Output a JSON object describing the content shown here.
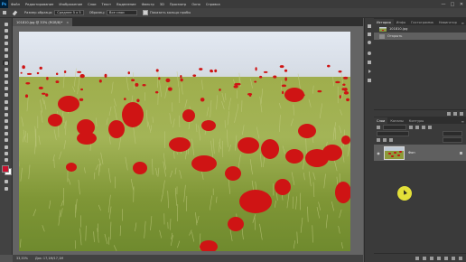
{
  "menubar": {
    "logo": "Ps",
    "items": [
      "Файл",
      "Редактирование",
      "Изображение",
      "Слои",
      "Текст",
      "Выделение",
      "Фильтр",
      "3D",
      "Просмотр",
      "Окно",
      "Справка"
    ],
    "window_controls": [
      "—",
      "□",
      "✕"
    ]
  },
  "options": {
    "size_label": "Размер образца:",
    "size_value": "Среднее 5 x 5",
    "sample_label": "Образец:",
    "sample_value": "Все слои",
    "ring_label": "Показать кольцо пробы"
  },
  "document": {
    "tab_title": "101810.jpg @ 33% (RGB/8)*",
    "close": "×"
  },
  "status": {
    "zoom": "33,33%",
    "doc_info": "Док: 17,1M/17,1M"
  },
  "history_panel": {
    "tabs": [
      "История",
      "Инфо",
      "Гистограмма",
      "Навигатор"
    ],
    "active_tab": "История",
    "menu": "≡",
    "rows": [
      {
        "label": "101810.jpg",
        "selected": false
      },
      {
        "label": "Открыть",
        "selected": true
      }
    ]
  },
  "layers_panel": {
    "tabs": [
      "Слои",
      "Каналы",
      "Контуры"
    ],
    "active_tab": "Слои",
    "menu": "≡",
    "layer": {
      "name": "Фон",
      "visible": true,
      "locked": true
    }
  },
  "colors": {
    "foreground": "#c8102e",
    "background": "#ffffff",
    "accent": "#31a8ff",
    "cursor_highlight": "#f2ef3a"
  },
  "tool_icons": [
    "move-icon",
    "marquee-icon",
    "lasso-icon",
    "quick-select-icon",
    "crop-icon",
    "frame-icon",
    "eyedropper-icon",
    "healing-brush-icon",
    "brush-icon",
    "clone-stamp-icon",
    "history-brush-icon",
    "eraser-icon",
    "gradient-icon",
    "blur-icon",
    "dodge-icon",
    "pen-icon",
    "type-icon",
    "path-select-icon",
    "rectangle-icon",
    "hand-icon",
    "zoom-icon",
    "more-tools-icon"
  ]
}
